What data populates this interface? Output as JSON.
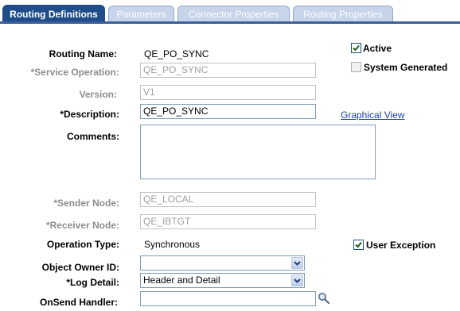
{
  "tabs": [
    "Routing Definitions",
    "Parameters",
    "Connector Properties",
    "Routing Properties"
  ],
  "form": {
    "routing_name": {
      "label": "Routing Name:",
      "value": "QE_PO_SYNC"
    },
    "service_operation": {
      "label": "*Service Operation:",
      "value": "QE_PO_SYNC"
    },
    "version": {
      "label": "Version:",
      "value": "V1"
    },
    "description": {
      "label": "*Description:",
      "value": "QE_PO_SYNC"
    },
    "comments": {
      "label": "Comments:",
      "value": ""
    },
    "sender_node": {
      "label": "*Sender Node:",
      "value": "QE_LOCAL"
    },
    "receiver_node": {
      "label": "*Receiver Node:",
      "value": "QE_IBTGT"
    },
    "operation_type": {
      "label": "Operation Type:",
      "value": "Synchronous"
    },
    "object_owner_id": {
      "label": "Object Owner ID:",
      "value": ""
    },
    "log_detail": {
      "label": "*Log Detail:",
      "value": "Header and Detail"
    },
    "onsend_handler": {
      "label": "OnSend Handler:",
      "value": ""
    }
  },
  "checkboxes": {
    "active": {
      "label": "Active",
      "checked": true
    },
    "system_generated": {
      "label": "System Generated",
      "checked": false
    },
    "user_exception": {
      "label": "User Exception",
      "checked": true
    }
  },
  "links": {
    "graphical_view": "Graphical View"
  },
  "icons": {
    "lookup": "magnifier-icon",
    "dropdown": "chevron-down-icon",
    "check": "checkmark-icon"
  },
  "colors": {
    "tab_active": "#1f4d8a",
    "tab_inactive": "#c7d4ea",
    "link": "#1d3fb0",
    "disabled_text": "#8c8c8c"
  }
}
